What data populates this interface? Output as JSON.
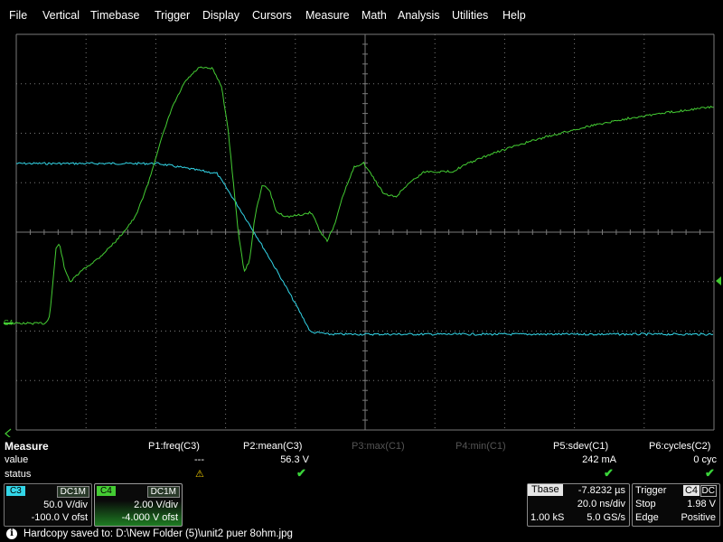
{
  "menu": [
    "File",
    "Vertical",
    "Timebase",
    "Trigger",
    "Display",
    "Cursors",
    "Measure",
    "Math",
    "Analysis",
    "Utilities",
    "Help"
  ],
  "colors": {
    "c3": "#33d6e8",
    "c4": "#44cc33",
    "grid": "#7a7a7a",
    "check": "#3ad33a",
    "warn": "#e8c400"
  },
  "markers": {
    "c4_ground": "C4"
  },
  "measure": {
    "title": "Measure",
    "rows": [
      "value",
      "status"
    ],
    "params": [
      {
        "label": "P1:freq(C3)",
        "value": "---",
        "status": "warn",
        "active": true
      },
      {
        "label": "P2:mean(C3)",
        "value": "56.3 V",
        "status": "check",
        "active": true
      },
      {
        "label": "P3:max(C1)",
        "value": "",
        "status": "",
        "active": false
      },
      {
        "label": "P4:min(C1)",
        "value": "",
        "status": "",
        "active": false
      },
      {
        "label": "P5:sdev(C1)",
        "value": "242 mA",
        "status": "check",
        "active": true
      },
      {
        "label": "P6:cycles(C2)",
        "value": "0 cyc",
        "status": "check",
        "active": true
      }
    ]
  },
  "channels": [
    {
      "name": "C3",
      "coupling": "DC1M",
      "vdiv": "50.0 V/div",
      "offset": "-100.0 V ofst",
      "color": "#33d6e8"
    },
    {
      "name": "C4",
      "coupling": "DC1M",
      "vdiv": "2.00 V/div",
      "offset": "-4.000 V ofst",
      "color": "#44cc33"
    }
  ],
  "timebase": {
    "label": "Tbase",
    "delay": "-7.8232 µs",
    "tdiv": "20.0 ns/div",
    "samples": "1.00 kS",
    "rate": "5.0 GS/s"
  },
  "trigger": {
    "label": "Trigger",
    "source": "C4",
    "coupling": "DC",
    "mode": "Stop",
    "level": "1.98 V",
    "type": "Edge",
    "slope": "Positive"
  },
  "status_bar": {
    "message": "Hardcopy saved to: D:\\New Folder (5)\\unit2 puer 8ohm.jpg",
    "icon": "info-icon"
  }
}
